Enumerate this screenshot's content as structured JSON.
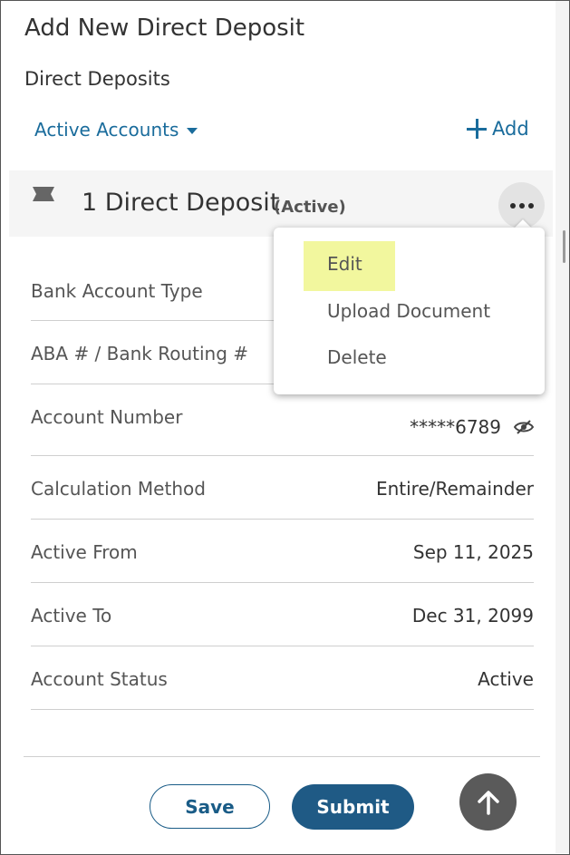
{
  "page": {
    "title": "Add New Direct Deposit",
    "section_title": "Direct Deposits"
  },
  "filter": {
    "label": "Active Accounts",
    "icon": "caret-down-icon"
  },
  "add_button": {
    "label": "Add",
    "icon": "plus-icon"
  },
  "card": {
    "icon": "ribbon-icon",
    "title": "1 Direct Deposit",
    "status": "(Active)",
    "more_icon": "ellipsis-icon"
  },
  "details": [
    {
      "label": "Bank Account Type",
      "value": ""
    },
    {
      "label": "ABA # / Bank Routing #",
      "value": ""
    },
    {
      "label": "Account Number",
      "value": "*****6789"
    },
    {
      "label": "Calculation Method",
      "value": "Entire/Remainder"
    },
    {
      "label": "Active From",
      "value": "Sep 11, 2025"
    },
    {
      "label": "Active To",
      "value": "Dec 31, 2099"
    },
    {
      "label": "Account Status",
      "value": "Active"
    }
  ],
  "menu": {
    "items": [
      "Edit",
      "Upload Document",
      "Delete"
    ],
    "highlighted": "Edit"
  },
  "footer": {
    "save_label": "Save",
    "submit_label": "Submit",
    "scroll_top_icon": "arrow-up-icon"
  },
  "colors": {
    "accent": "#1a6c9c",
    "primary_button": "#1f5a85",
    "highlight": "#f2f79e",
    "header_bg": "#f5f5f5"
  }
}
